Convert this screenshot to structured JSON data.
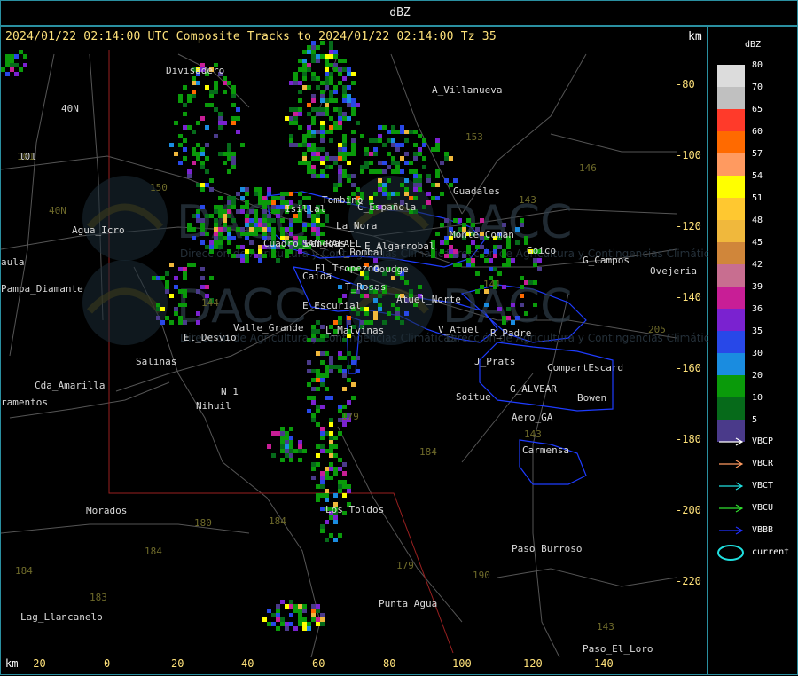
{
  "header": {
    "title": "dBZ"
  },
  "map": {
    "headline": "2024/01/22 02:14:00 UTC Composite Tracks to 2024/01/22 02:14:00 Tz 35",
    "unit_top": "km",
    "unit_bottom": "km",
    "x_ticks": [
      "-20",
      "0",
      "20",
      "40",
      "60",
      "80",
      "100",
      "120",
      "140"
    ],
    "y_ticks": [
      "-80",
      "-100",
      "-120",
      "-140",
      "-160",
      "-180",
      "-200",
      "-220"
    ],
    "places": [
      "Divisadero",
      "A_Villanueva",
      "40N",
      "101",
      "Agua_Icro",
      "Pampa_Diamante",
      "C_Española",
      "Tombino",
      "Isillal",
      "La_Nora",
      "SAN_RAFAEL",
      "C_Bombal",
      "E_Algarrobal",
      "Guadales",
      "Monte_Coman",
      "Goico",
      "G_Campos",
      "Ovejeria",
      "T_Rosas",
      "Atuel_Norte",
      "E_Escurial",
      "Valle_Grande",
      "L_Malvinas",
      "V_Atuel",
      "R_Padre",
      "El_Desvio",
      "Salinas",
      "J_Prats",
      "CompartEscard",
      "Cda_Amarilla",
      "G_ALVEAR",
      "Bowen",
      "Soitue",
      "N_1",
      "Nihuil",
      "Aero_GA",
      "Carmensa",
      "Morados",
      "Los_Toldos",
      "Paso_Burroso",
      "Punta_Agua",
      "Lag_Llancanelo",
      "Paso_El_Loro",
      "El_Tropezon",
      "Goudge",
      "Cuadro_Benegas",
      "Caida",
      "ramentos",
      "aula"
    ],
    "watermark_text": "DACC",
    "watermark_sub": "Dirección de Agricultura y Contingencias Climáticas"
  },
  "legend": {
    "title": "dBZ",
    "scale": [
      {
        "label": "80",
        "color": "#dcdcdc"
      },
      {
        "label": "70",
        "color": "#c0c0c0"
      },
      {
        "label": "65",
        "color": "#ff3a2a"
      },
      {
        "label": "60",
        "color": "#ff6a00"
      },
      {
        "label": "57",
        "color": "#ff9a60"
      },
      {
        "label": "54",
        "color": "#ffff00"
      },
      {
        "label": "51",
        "color": "#ffc830"
      },
      {
        "label": "48",
        "color": "#f0b83c"
      },
      {
        "label": "45",
        "color": "#d0863a"
      },
      {
        "label": "42",
        "color": "#c86e90"
      },
      {
        "label": "39",
        "color": "#c81e96"
      },
      {
        "label": "36",
        "color": "#7a22d0"
      },
      {
        "label": "35",
        "color": "#2848e8"
      },
      {
        "label": "30",
        "color": "#1a8ce0"
      },
      {
        "label": "20",
        "color": "#0a9a0a"
      },
      {
        "label": "10",
        "color": "#066a1a"
      },
      {
        "label": "5",
        "color": "#4a3a8a"
      }
    ],
    "tracks": [
      {
        "label": "VBCP",
        "color": "#ffffff"
      },
      {
        "label": "VBCR",
        "color": "#ff9a60"
      },
      {
        "label": "VBCT",
        "color": "#20e0e0"
      },
      {
        "label": "VBCU",
        "color": "#30e030"
      },
      {
        "label": "VBBB",
        "color": "#2030ff"
      },
      {
        "label": "current",
        "color": "#20e0e0"
      }
    ]
  }
}
